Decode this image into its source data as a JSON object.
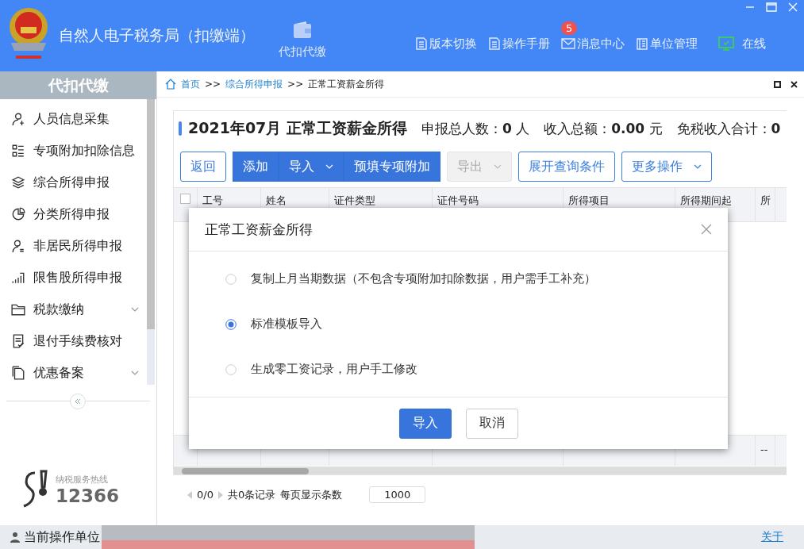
{
  "window": {
    "title": "自然人电子税务局（扣缴端）",
    "module": "代扣代缴",
    "tools": [
      {
        "label": "版本切换"
      },
      {
        "label": "操作手册"
      },
      {
        "label": "消息中心",
        "badge": "5"
      },
      {
        "label": "单位管理"
      }
    ],
    "status": "在线"
  },
  "sidebar": {
    "title": "代扣代缴",
    "items": [
      {
        "label": "人员信息采集",
        "expandable": false
      },
      {
        "label": "专项附加扣除信息",
        "expandable": false
      },
      {
        "label": "综合所得申报",
        "expandable": false
      },
      {
        "label": "分类所得申报",
        "expandable": false
      },
      {
        "label": "非居民所得申报",
        "expandable": false
      },
      {
        "label": "限售股所得申报",
        "expandable": false
      },
      {
        "label": "税款缴纳",
        "expandable": true
      },
      {
        "label": "退付手续费核对",
        "expandable": false
      },
      {
        "label": "优惠备案",
        "expandable": true
      }
    ],
    "hotline": {
      "label": "纳税服务热线",
      "number": "12366"
    }
  },
  "breadcrumb": {
    "items": [
      "首页",
      "综合所得申报",
      "正常工资薪金所得"
    ],
    "separator": ">>"
  },
  "summary": {
    "title": "2021年07月 正常工资薪金所得",
    "stats": [
      {
        "label": "申报总人数：",
        "value": "0",
        "unit": "人"
      },
      {
        "label": "收入总额：",
        "value": "0.00",
        "unit": "元"
      },
      {
        "label": "免税收入合计：",
        "value": "0"
      }
    ]
  },
  "toolbar": [
    {
      "label": "返回",
      "kind": "outline",
      "dropdown": false
    },
    {
      "label": "添加",
      "kind": "primary",
      "dropdown": false
    },
    {
      "label": "导入",
      "kind": "primary",
      "dropdown": true
    },
    {
      "label": "预填专项附加",
      "kind": "primary",
      "dropdown": false
    },
    {
      "label": "导出",
      "kind": "disabled",
      "dropdown": true
    },
    {
      "label": "展开查询条件",
      "kind": "outline",
      "dropdown": false
    },
    {
      "label": "更多操作",
      "kind": "outline",
      "dropdown": true
    }
  ],
  "table": {
    "select_all": {
      "checked": false
    },
    "columns": [
      "工号",
      "姓名",
      "证件类型",
      "证件号码",
      "所得项目",
      "所得期间起",
      "所"
    ],
    "total_row_last_cell": "--"
  },
  "pagination": {
    "pages": "0/0",
    "records": "共0条记录",
    "page_size_label": "每页显示条数",
    "page_size": "1000"
  },
  "dialog": {
    "title": "正常工资薪金所得",
    "options": [
      {
        "label": "复制上月当期数据（不包含专项附加扣除数据，用户需手工补充）",
        "selected": false
      },
      {
        "label": "标准模板导入",
        "selected": true
      },
      {
        "label": "生成零工资记录，用户手工修改",
        "selected": false
      }
    ],
    "buttons": [
      {
        "label": "导入",
        "kind": "primary"
      },
      {
        "label": "取消",
        "kind": "default"
      }
    ]
  },
  "status_bar": {
    "label": "当前操作单位",
    "link": "关于"
  }
}
